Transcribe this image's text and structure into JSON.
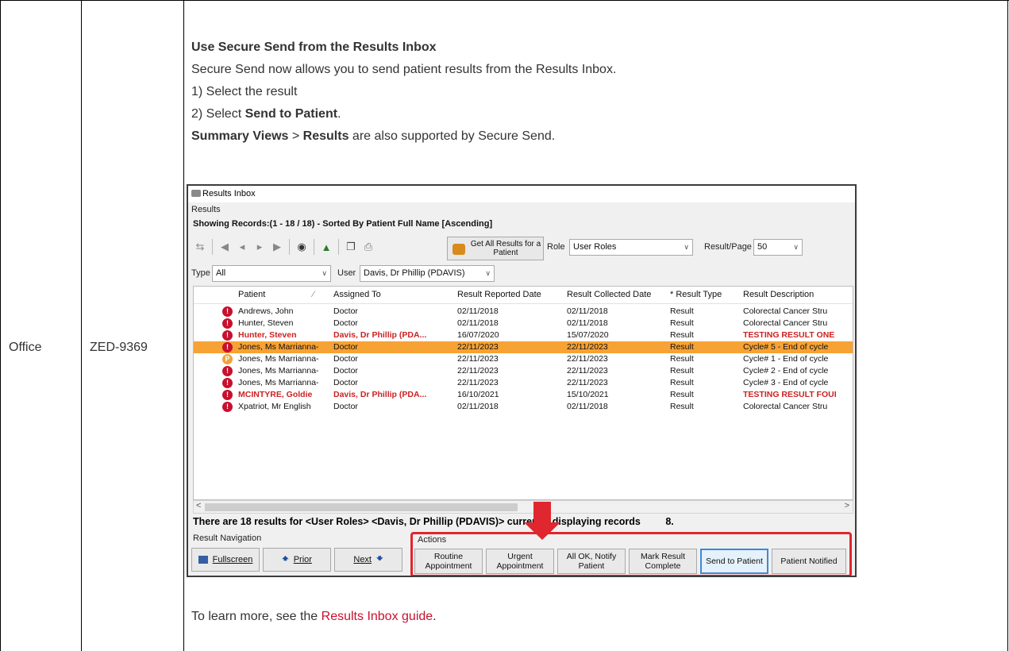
{
  "table": {
    "product": "Office",
    "ticket": "ZED-9369"
  },
  "content": {
    "heading": "Use Secure Send from the Results Inbox",
    "intro": "Secure Send now allows you to send patient results from the Results Inbox.",
    "step1": "1) Select the result",
    "step2_prefix": "2) Select ",
    "step2_bold": "Send to Patient",
    "step2_suffix": ".",
    "summary_part1": "Summary Views",
    "summary_sep": " > ",
    "summary_part2": "Results",
    "summary_suffix": " are also supported by Secure Send.",
    "learn_prefix": "To learn more, see the ",
    "learn_link": "Results Inbox guide",
    "learn_suffix": "."
  },
  "screenshot": {
    "window_title": "Results Inbox",
    "group_results": "Results",
    "showing": "Showing Records:(1 - 18 / 18) - Sorted By Patient Full Name [Ascending]",
    "get_all_results": "Get All Results for a Patient",
    "role_label": "Role",
    "role_value": "User Roles",
    "result_page_label": "Result/Page",
    "result_page_value": "50",
    "type_label": "Type",
    "type_value": "All",
    "user_label": "User",
    "user_value": "Davis, Dr Phillip (PDAVIS)",
    "columns": {
      "patient": "Patient",
      "assigned_to": "Assigned To",
      "reported": "Result Reported Date",
      "collected": "Result Collected Date",
      "type": "* Result Type",
      "description": "Result Description"
    },
    "rows": [
      {
        "patient": "Andrews, John",
        "assigned": "Doctor",
        "reported": "02/11/2018",
        "collected": "02/11/2018",
        "type": "Result",
        "desc": "Colorectal Cancer Stru"
      },
      {
        "patient": "Hunter, Steven",
        "assigned": "Doctor",
        "reported": "02/11/2018",
        "collected": "02/11/2018",
        "type": "Result",
        "desc": "Colorectal Cancer Stru"
      },
      {
        "patient": "Hunter, Steven",
        "assigned": "Davis, Dr Phillip (PDA...",
        "reported": "16/07/2020",
        "collected": "15/07/2020",
        "type": "Result",
        "desc": "TESTING RESULT ONE"
      },
      {
        "patient": "Jones, Ms Marrianna-",
        "assigned": "Doctor",
        "reported": "22/11/2023",
        "collected": "22/11/2023",
        "type": "Result",
        "desc": "Cycle# 5 - End of cycle"
      },
      {
        "patient": "Jones, Ms Marrianna-",
        "assigned": "Doctor",
        "reported": "22/11/2023",
        "collected": "22/11/2023",
        "type": "Result",
        "desc": "Cycle# 1 - End of cycle"
      },
      {
        "patient": "Jones, Ms Marrianna-",
        "assigned": "Doctor",
        "reported": "22/11/2023",
        "collected": "22/11/2023",
        "type": "Result",
        "desc": "Cycle# 2 - End of cycle"
      },
      {
        "patient": "Jones, Ms Marrianna-",
        "assigned": "Doctor",
        "reported": "22/11/2023",
        "collected": "22/11/2023",
        "type": "Result",
        "desc": "Cycle# 3 - End of cycle"
      },
      {
        "patient": "MCINTYRE, Goldie",
        "assigned": "Davis, Dr Phillip (PDA...",
        "reported": "16/10/2021",
        "collected": "15/10/2021",
        "type": "Result",
        "desc": "TESTING RESULT FOUI"
      },
      {
        "patient": "Xpatriot, Mr English",
        "assigned": "Doctor",
        "reported": "02/11/2018",
        "collected": "02/11/2018",
        "type": "Result",
        "desc": "Colorectal Cancer Stru"
      }
    ],
    "summary_line": "There are 18 results for <User Roles> <Davis, Dr Phillip (PDAVIS)> currently displaying records",
    "summary_tail": "8.",
    "nav_group": "Result Navigation",
    "fullscreen": "Fullscreen",
    "prior": "Prior",
    "next": "Next",
    "actions_group": "Actions",
    "actions": [
      "Routine Appointment",
      "Urgent Appointment",
      "All OK, Notify Patient",
      "Mark Result Complete",
      "Send to Patient",
      "Patient Notified"
    ]
  }
}
